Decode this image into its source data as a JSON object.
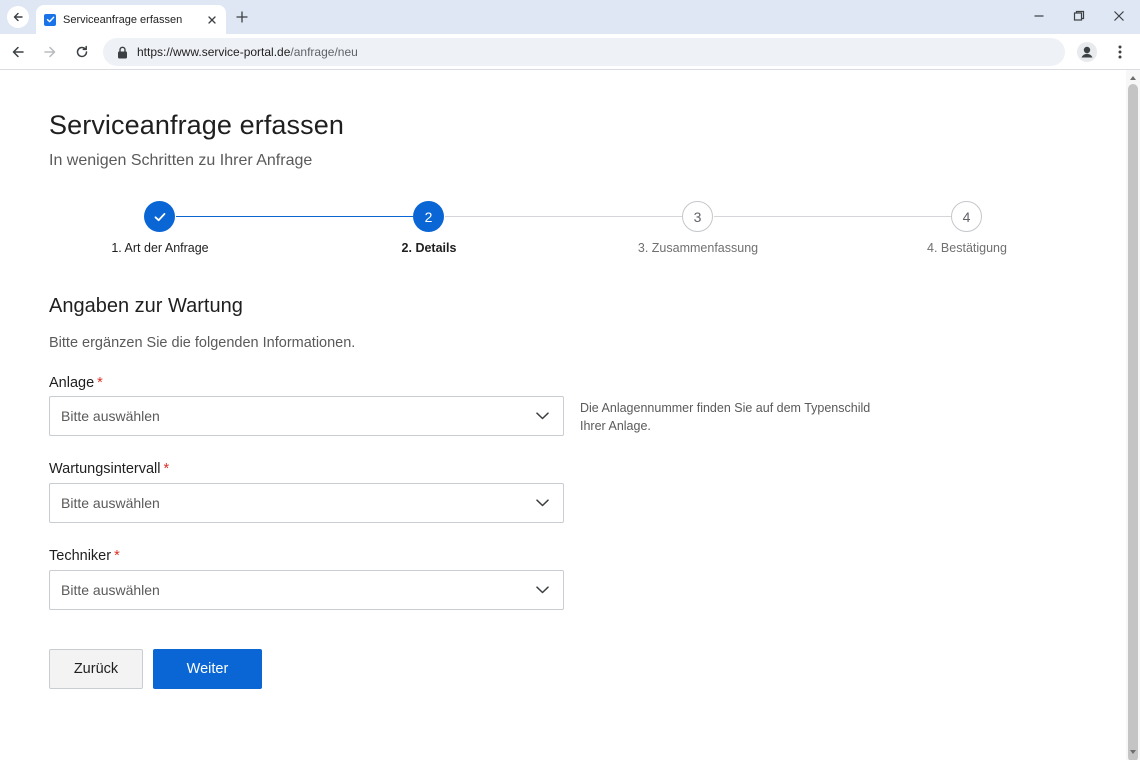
{
  "browser": {
    "tab_title": "Serviceanfrage erfassen",
    "url_host": "https://www.service-portal.de",
    "url_path": "/anfrage/neu"
  },
  "page": {
    "title": "Serviceanfrage erfassen",
    "subtitle": "In wenigen Schritten zu Ihrer Anfrage"
  },
  "stepper": {
    "steps": [
      {
        "number": "",
        "label": "1. Art der Anfrage",
        "status": "done"
      },
      {
        "number": "2",
        "label": "2. Details",
        "status": "active"
      },
      {
        "number": "3",
        "label": "3. Zusammenfassung",
        "status": "todo"
      },
      {
        "number": "4",
        "label": "4. Bestätigung",
        "status": "todo"
      }
    ]
  },
  "section": {
    "title": "Angaben zur Wartung",
    "description": "Bitte ergänzen Sie die folgenden Informationen."
  },
  "fields": {
    "anlage": {
      "label": "Anlage",
      "required_mark": "*",
      "value": "Bitte auswählen",
      "hint": "Die Anlagennummer finden Sie auf dem Typenschild Ihrer Anlage."
    },
    "wartungsintervall": {
      "label": "Wartungsintervall",
      "required_mark": "*",
      "value": "Bitte auswählen"
    },
    "techniker": {
      "label": "Techniker",
      "required_mark": "*",
      "value": "Bitte auswählen"
    }
  },
  "buttons": {
    "back": "Zurück",
    "next": "Weiter"
  },
  "colors": {
    "primary": "#0a66d4",
    "required": "#d93025",
    "tabbar": "#dfe7f4"
  }
}
